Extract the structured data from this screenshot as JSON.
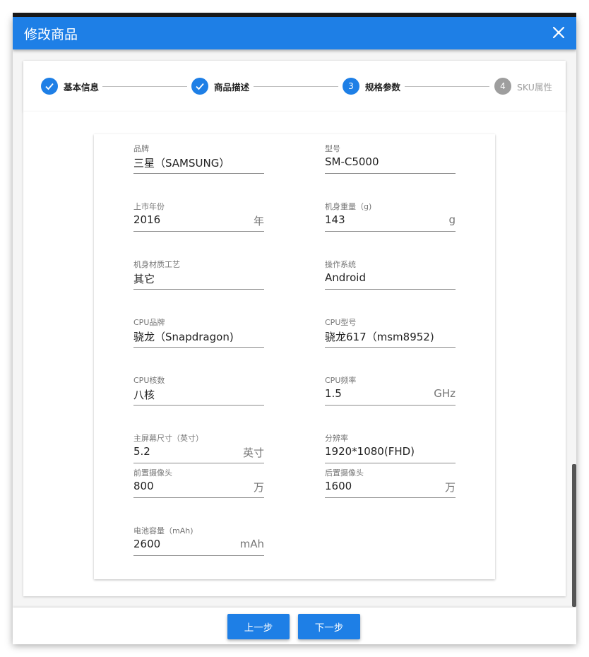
{
  "dialog": {
    "title": "修改商品"
  },
  "stepper": {
    "steps": [
      {
        "label": "基本信息",
        "state": "done"
      },
      {
        "label": "商品描述",
        "state": "done"
      },
      {
        "number": "3",
        "label": "规格参数",
        "state": "active"
      },
      {
        "number": "4",
        "label": "SKU属性",
        "state": "pending"
      }
    ]
  },
  "specs": {
    "brand": {
      "label": "品牌",
      "value": "三星（SAMSUNG）"
    },
    "model": {
      "label": "型号",
      "value": "SM-C5000"
    },
    "release_year": {
      "label": "上市年份",
      "value": "2016",
      "unit": "年"
    },
    "weight": {
      "label": "机身重量（g)",
      "value": "143",
      "unit": "g"
    },
    "material": {
      "label": "机身材质工艺",
      "value": "其它"
    },
    "os": {
      "label": "操作系统",
      "value": "Android"
    },
    "cpu_brand": {
      "label": "CPU品牌",
      "value": "骁龙（Snapdragon)"
    },
    "cpu_model": {
      "label": "CPU型号",
      "value": "骁龙617（msm8952)"
    },
    "cpu_cores": {
      "label": "CPU核数",
      "value": "八核"
    },
    "cpu_freq": {
      "label": "CPU频率",
      "value": "1.5",
      "unit": "GHz"
    },
    "screen_size": {
      "label": "主屏幕尺寸（英寸）",
      "value": "5.2",
      "unit": "英寸"
    },
    "resolution": {
      "label": "分辨率",
      "value": "1920*1080(FHD)"
    },
    "front_camera": {
      "label": "前置摄像头",
      "value": "800",
      "unit": "万"
    },
    "rear_camera": {
      "label": "后置摄像头",
      "value": "1600",
      "unit": "万"
    },
    "battery": {
      "label": "电池容量（mAh)",
      "value": "2600",
      "unit": "mAh"
    }
  },
  "footer": {
    "prev_label": "上一步",
    "next_label": "下一步"
  },
  "colors": {
    "primary": "#1e7fe6",
    "inactive_step": "#9e9e9e"
  }
}
